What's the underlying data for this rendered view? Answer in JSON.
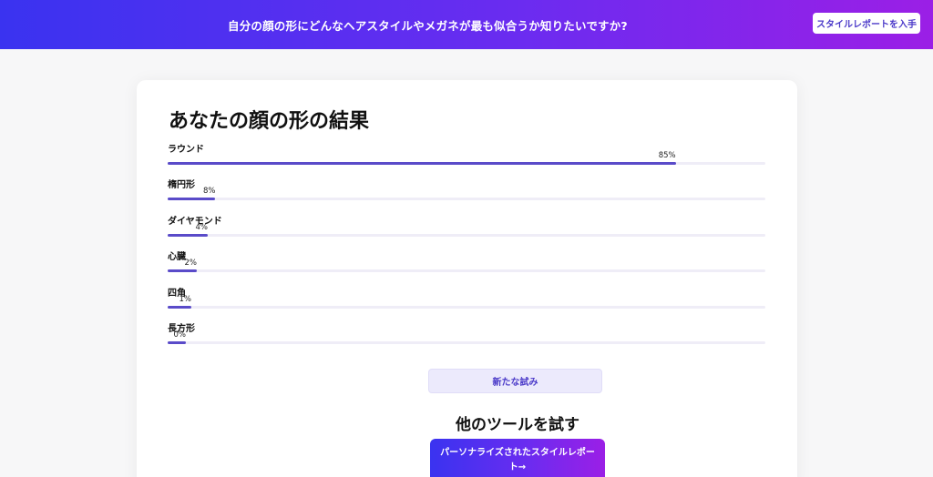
{
  "banner": {
    "text": "自分の顔の形にどんなヘアスタイルやメガネが最も似合うか知りたいですか?",
    "button_label": "スタイルレポートを入手"
  },
  "results": {
    "title": "あなたの顔の形の結果",
    "shapes": [
      {
        "label": "ラウンド",
        "percent_text": "85%",
        "percent": 85
      },
      {
        "label": "楕円形",
        "percent_text": "8%",
        "percent": 8
      },
      {
        "label": "ダイヤモンド",
        "percent_text": "4%",
        "percent": 4
      },
      {
        "label": "心臓",
        "percent_text": "2%",
        "percent": 2
      },
      {
        "label": "四角",
        "percent_text": "1%",
        "percent": 1
      },
      {
        "label": "長方形",
        "percent_text": "0%",
        "percent": 0
      }
    ],
    "retry_label": "新たな試み"
  },
  "tools": {
    "title": "他のツールを試す",
    "report_button_line1": "パーソナライズされたスタイルレポー",
    "report_button_line2": "ト→"
  },
  "colors": {
    "accent": "#5a4bc9",
    "gradient_start": "#3a33f0",
    "gradient_end": "#9b1fe6",
    "track": "#efedf7"
  }
}
